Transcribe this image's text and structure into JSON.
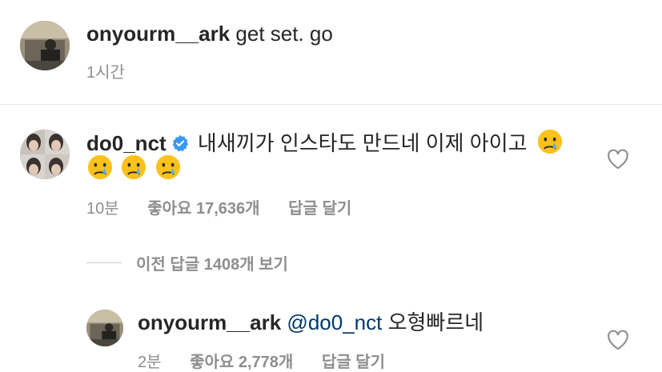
{
  "caption": {
    "username": "onyourm__ark",
    "text": "get set. go",
    "time": "1시간"
  },
  "comment": {
    "username": "do0_nct",
    "verified": true,
    "text": "내새끼가 인스타도 만드네 이제 아이고",
    "emoji": "crying-face",
    "time": "10분",
    "likes_label": "좋아요 17,636개",
    "reply_label": "답글 달기"
  },
  "view_replies": "이전 답글 1408개 보기",
  "reply": {
    "username": "onyourm__ark",
    "mention": "@do0_nct",
    "text": "오형빠르네",
    "time": "2분",
    "likes_label": "좋아요 2,778개",
    "reply_label": "답글 달기"
  },
  "colors": {
    "text": "#262626",
    "meta": "#8e8e8e",
    "mention": "#00376b",
    "verified": "#3897f0"
  }
}
